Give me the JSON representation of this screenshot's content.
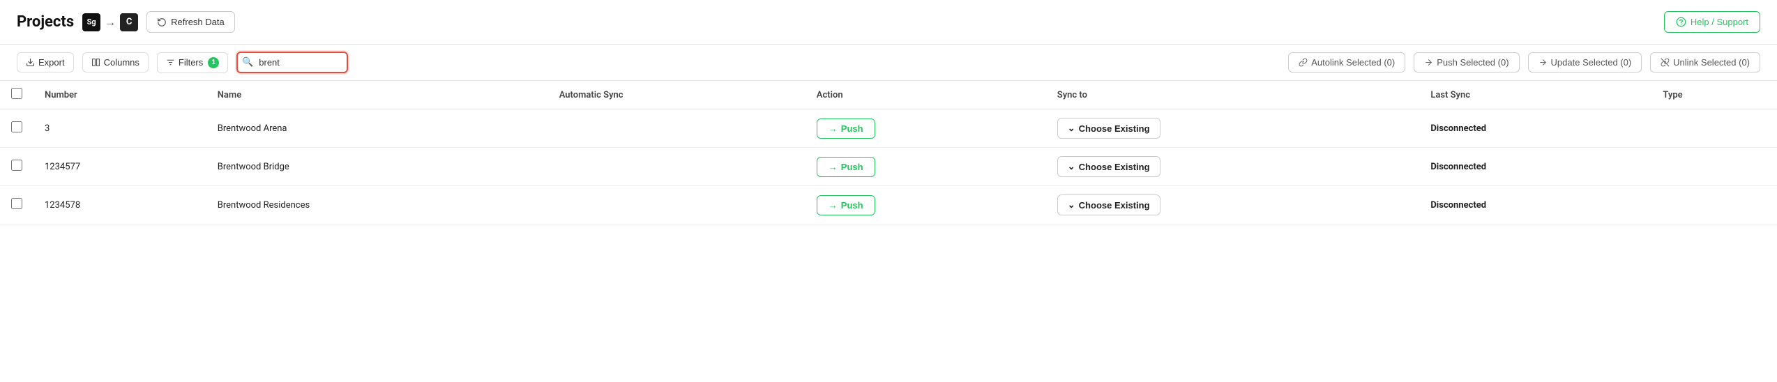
{
  "header": {
    "title": "Projects",
    "icon1_label": "Sg",
    "arrow": "→",
    "icon2_label": "C",
    "refresh_btn": "Refresh Data",
    "help_btn": "Help / Support"
  },
  "toolbar": {
    "export_label": "Export",
    "columns_label": "Columns",
    "filters_label": "Filters",
    "filter_badge": "1",
    "search_placeholder": "brent",
    "search_value": "brent",
    "autolink_label": "Autolink Selected (0)",
    "push_selected_label": "Push Selected (0)",
    "update_selected_label": "Update Selected (0)",
    "unlink_selected_label": "Unlink Selected (0)"
  },
  "table": {
    "columns": [
      "",
      "Number",
      "Name",
      "Automatic Sync",
      "Action",
      "Sync to",
      "Last Sync",
      "Type"
    ],
    "rows": [
      {
        "number": "3",
        "name": "Brentwood Arena",
        "automatic_sync": "",
        "action": "Push",
        "sync_to": "Choose Existing",
        "last_sync": "Disconnected",
        "type": ""
      },
      {
        "number": "1234577",
        "name": "Brentwood Bridge",
        "automatic_sync": "",
        "action": "Push",
        "sync_to": "Choose Existing",
        "last_sync": "Disconnected",
        "type": ""
      },
      {
        "number": "1234578",
        "name": "Brentwood Residences",
        "automatic_sync": "",
        "action": "Push",
        "sync_to": "Choose Existing",
        "last_sync": "Disconnected",
        "type": ""
      }
    ]
  }
}
